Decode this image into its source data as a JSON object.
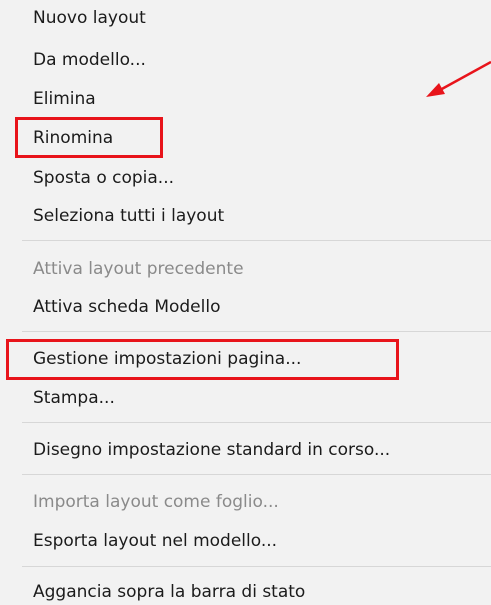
{
  "menu": {
    "items": [
      {
        "label": "Nuovo layout",
        "enabled": true
      },
      {
        "label": "Da modello...",
        "enabled": true
      },
      {
        "label": "Elimina",
        "enabled": true
      },
      {
        "label": "Rinomina",
        "enabled": true,
        "highlighted": true
      },
      {
        "label": "Sposta o copia...",
        "enabled": true
      },
      {
        "label": "Seleziona tutti i layout",
        "enabled": true
      },
      {
        "label": "Attiva layout precedente",
        "enabled": false
      },
      {
        "label": "Attiva scheda Modello",
        "enabled": true
      },
      {
        "label": "Gestione impostazioni pagina...",
        "enabled": true,
        "highlighted": true
      },
      {
        "label": "Stampa...",
        "enabled": true
      },
      {
        "label": "Disegno impostazione standard in corso...",
        "enabled": true
      },
      {
        "label": "Importa layout come foglio...",
        "enabled": false
      },
      {
        "label": "Esporta layout nel modello...",
        "enabled": true
      },
      {
        "label": "Aggancia sopra la barra di stato",
        "enabled": true
      }
    ]
  },
  "colors": {
    "menu_background": "#f2f2f2",
    "text": "#1b1b1b",
    "disabled_text": "#8a8a8a",
    "separator": "#d7d7d7",
    "annotation": "#e8141b"
  },
  "annotation": {
    "arrow_icon": "red-arrow-icon"
  }
}
